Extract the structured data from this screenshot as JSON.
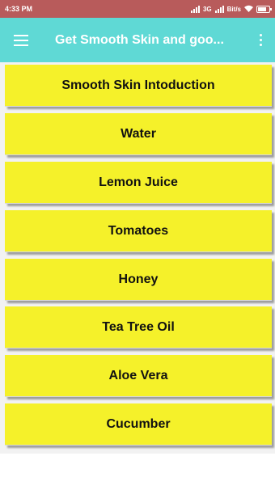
{
  "status_bar": {
    "time": "4:33 PM",
    "network": "3G",
    "speed": "Bit/s"
  },
  "app_bar": {
    "title": "Get Smooth Skin and goo..."
  },
  "topics": [
    {
      "label": "Smooth Skin Intoduction"
    },
    {
      "label": "Water"
    },
    {
      "label": "Lemon Juice"
    },
    {
      "label": "Tomatoes"
    },
    {
      "label": "Honey"
    },
    {
      "label": "Tea Tree Oil"
    },
    {
      "label": "Aloe Vera"
    },
    {
      "label": "Cucumber"
    }
  ],
  "colors": {
    "status_bar": "#b85b5b",
    "app_bar": "#5fd9d5",
    "button": "#f5f12a",
    "background": "#f2f2f2"
  }
}
